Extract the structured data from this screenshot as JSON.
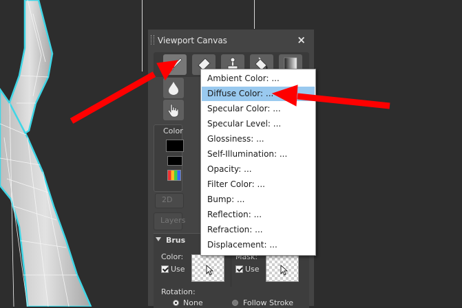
{
  "panel": {
    "title": "Viewport Canvas",
    "close_glyph": "×",
    "tools": [
      "paint-brush-icon",
      "eraser-icon",
      "clone-stamp-icon",
      "fill-bucket-icon",
      "gradient-icon"
    ],
    "side_tools": [
      "blur-drop-icon",
      "smudge-hand-icon"
    ],
    "color_label": "Color",
    "btn_2d": "2D",
    "layers_label": "Layers"
  },
  "brush": {
    "title": "Brus",
    "color_label": "Color:",
    "mask_label": "Mask:",
    "use_label": "Use",
    "rotation_label": "Rotation:",
    "rotation_none": "None",
    "rotation_follow": "Follow Stroke"
  },
  "menu": {
    "items": [
      "Ambient Color: ...",
      "Diffuse Color: ...",
      "Specular Color: ...",
      "Specular Level: ...",
      "Glossiness: ...",
      "Self-Illumination: ...",
      "Opacity: ...",
      "Filter Color: ...",
      "Bump: ...",
      "Reflection: ...",
      "Refraction: ...",
      "Displacement: ..."
    ],
    "highlighted_index": 1
  },
  "colors": {
    "highlight": "#99c9ef",
    "arrow": "#ff0000",
    "panel_bg": "#444444",
    "mesh_outline": "#3fd6e6"
  }
}
